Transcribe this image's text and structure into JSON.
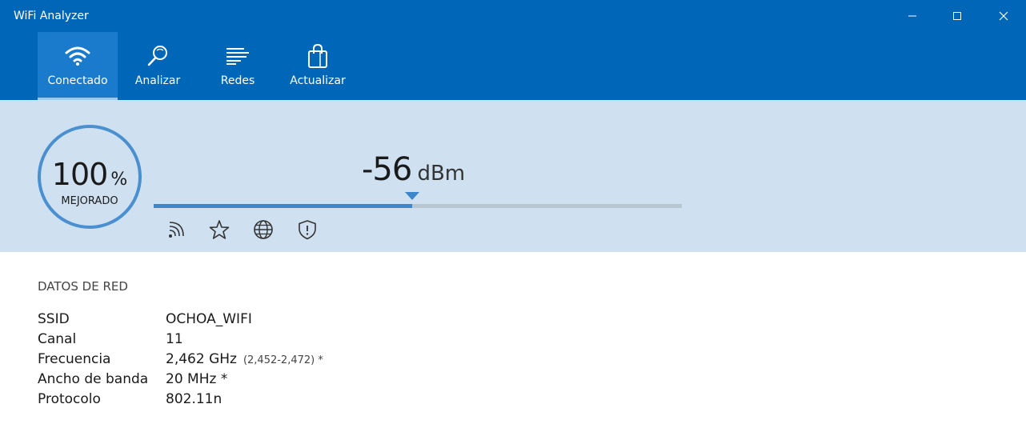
{
  "window": {
    "title": "WiFi Analyzer"
  },
  "nav": {
    "items": [
      {
        "label": "Conectado",
        "icon": "wifi-icon",
        "active": true
      },
      {
        "label": "Analizar",
        "icon": "magnifier-icon",
        "active": false
      },
      {
        "label": "Redes",
        "icon": "list-icon",
        "active": false
      },
      {
        "label": "Actualizar",
        "icon": "shopping-bag-icon",
        "active": false
      }
    ]
  },
  "signal": {
    "quality_value": "100",
    "quality_unit": "%",
    "quality_state": "MEJORADO",
    "dbm_value": "-56",
    "dbm_unit": "dBm",
    "meter_level": 0.49,
    "status_icons": [
      "signal-icon",
      "star-icon",
      "globe-icon",
      "shield-icon"
    ]
  },
  "network": {
    "section_title": "DATOS DE RED",
    "rows": [
      {
        "key": "SSID",
        "value": "OCHOA_WIFI",
        "extra": ""
      },
      {
        "key": "Canal",
        "value": "11",
        "extra": ""
      },
      {
        "key": "Frecuencia",
        "value": "2,462 GHz",
        "extra": "(2,452-2,472) *"
      },
      {
        "key": "Ancho de banda",
        "value": "20 MHz *",
        "extra": ""
      },
      {
        "key": "Protocolo",
        "value": "802.11n",
        "extra": ""
      }
    ]
  },
  "colors": {
    "header_bg": "#0067b8",
    "panel_bg": "#cfe0f0",
    "accent": "#3c86cc"
  }
}
